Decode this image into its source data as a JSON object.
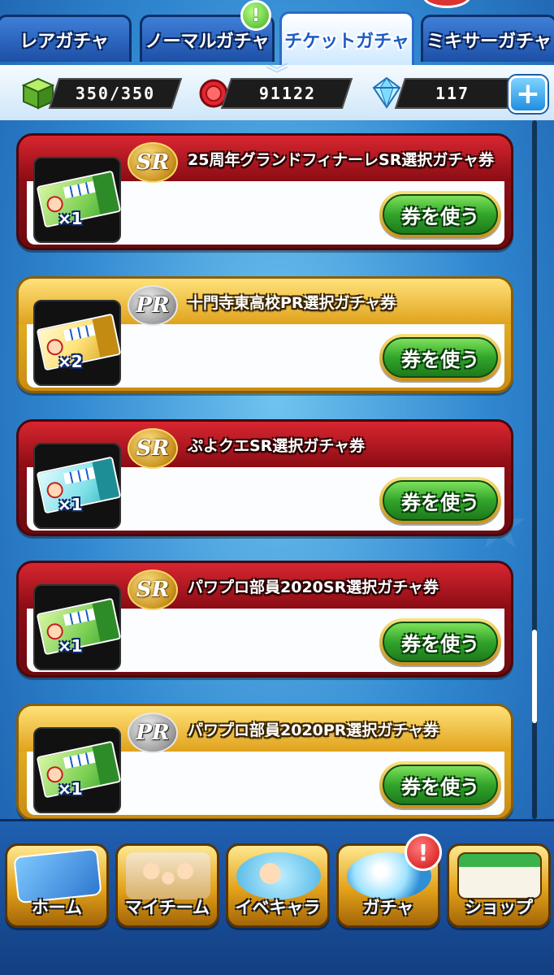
{
  "tabs": [
    {
      "label": "レアガチャ"
    },
    {
      "label": "ノーマルガチャ"
    },
    {
      "label": "チケットガチャ"
    },
    {
      "label": "ミキサーガチャ"
    }
  ],
  "tab_badge": "!",
  "currencies": {
    "stamina": "350/350",
    "coins": "91122",
    "gems": "117",
    "add_label": "+"
  },
  "tickets": [
    {
      "rank": "SR",
      "title": "25周年グランドフィナーレSR選択ガチャ券",
      "count": "×1",
      "button": "券を使う"
    },
    {
      "rank": "PR",
      "title": "十門寺東高校PR選択ガチャ券",
      "count": "×2",
      "button": "券を使う"
    },
    {
      "rank": "SR",
      "title": "ぷよクエSR選択ガチャ券",
      "count": "×1",
      "button": "券を使う"
    },
    {
      "rank": "SR",
      "title": "パワプロ部員2020SR選択ガチャ券",
      "count": "×1",
      "button": "券を使う"
    },
    {
      "rank": "PR",
      "title": "パワプロ部員2020PR選択ガチャ券",
      "count": "×1",
      "button": "券を使う"
    }
  ],
  "nav": [
    {
      "label": "ホーム"
    },
    {
      "label": "マイチーム"
    },
    {
      "label": "イベキャラ"
    },
    {
      "label": "ガチャ"
    },
    {
      "label": "ショップ"
    }
  ],
  "nav_alert": "!",
  "colors": {
    "sr_frame": "#a4101a",
    "pr_frame": "#f1c12b",
    "button_green": "#31a52a",
    "nav_gold": "#e3a11a"
  }
}
